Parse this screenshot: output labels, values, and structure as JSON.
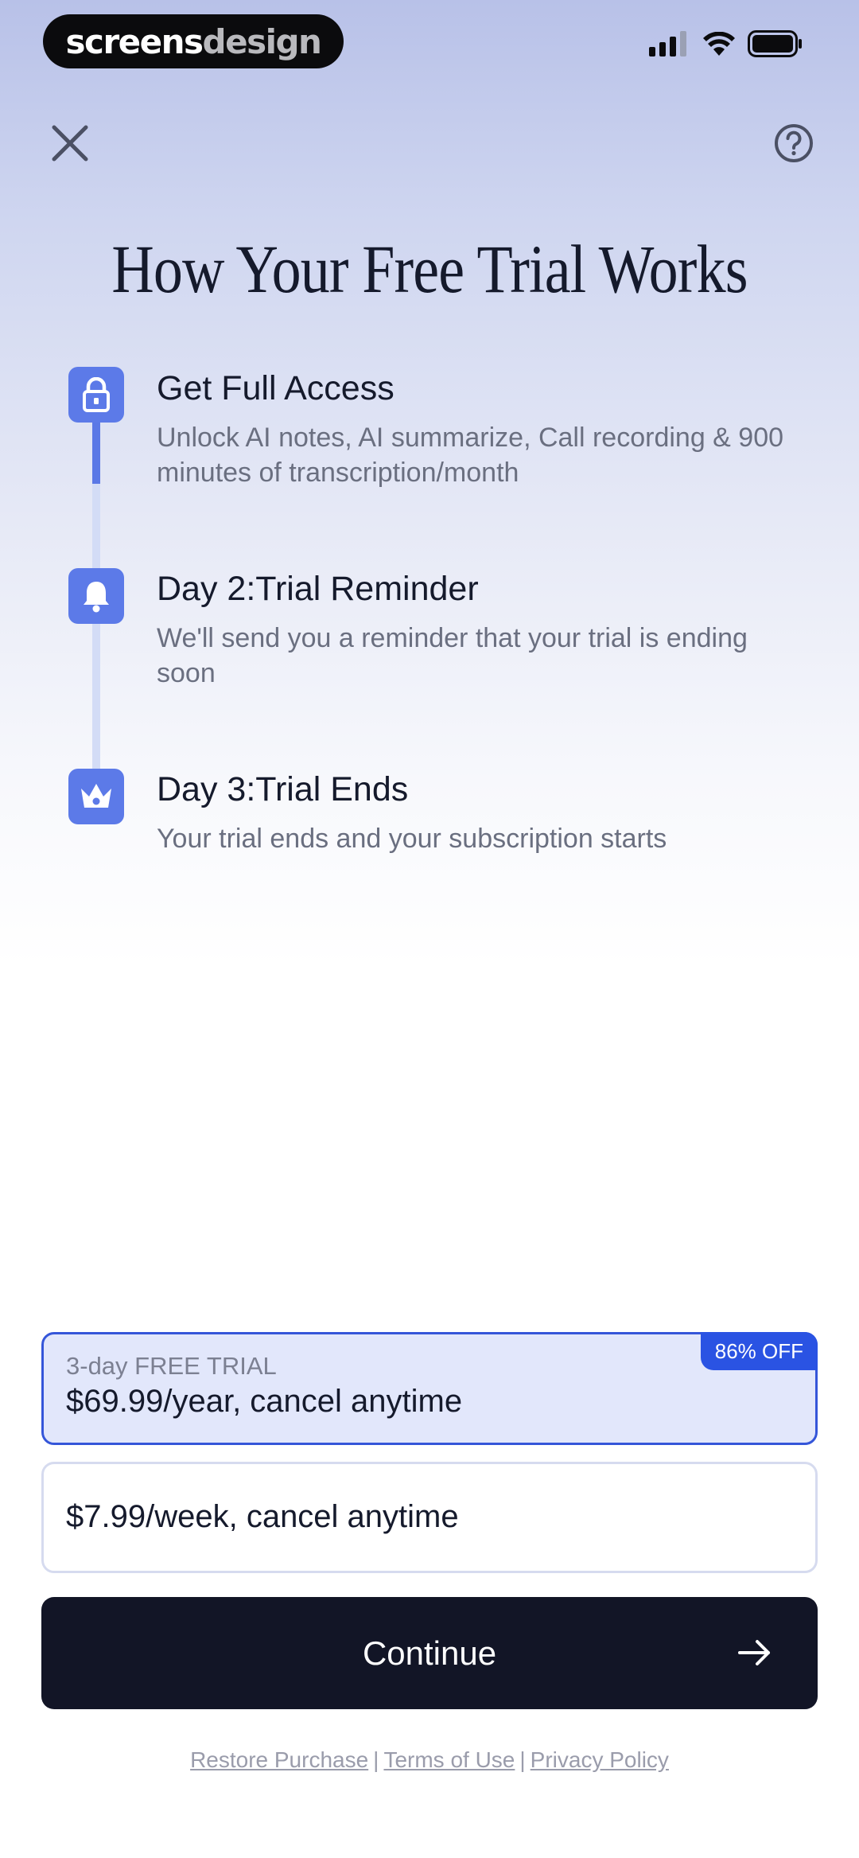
{
  "status_bar": {
    "brand_part1": "screens",
    "brand_part2": "design",
    "icons": [
      "cellular-signal-icon",
      "wifi-icon",
      "battery-icon"
    ]
  },
  "header": {
    "close_icon": "close-icon",
    "help_icon": "question-circle-icon"
  },
  "title": "How Your Free Trial Works",
  "steps": [
    {
      "icon": "lock-icon",
      "title": "Get Full Access",
      "description": "Unlock AI notes, AI summarize, Call recording & 900 minutes of transcription/month"
    },
    {
      "icon": "bell-icon",
      "title": "Day 2:Trial Reminder",
      "description": "We'll send you a reminder that your trial is ending soon"
    },
    {
      "icon": "crown-icon",
      "title": "Day 3:Trial Ends",
      "description": "Your trial ends and your subscription starts"
    }
  ],
  "plans": [
    {
      "trial": "3-day FREE TRIAL",
      "price": "$69.99/year, cancel anytime",
      "badge": "86% OFF",
      "selected": true
    },
    {
      "price": "$7.99/week, cancel anytime",
      "selected": false
    }
  ],
  "continue": {
    "label": "Continue",
    "icon": "arrow-right-icon"
  },
  "footer": {
    "restore": "Restore Purchase",
    "separator": "|",
    "terms": "Terms of Use",
    "privacy": "Privacy Policy"
  },
  "colors": {
    "accent": "#5c7ae8",
    "selected_border": "#3556d9",
    "badge": "#2a53e3",
    "button": "#121526"
  }
}
